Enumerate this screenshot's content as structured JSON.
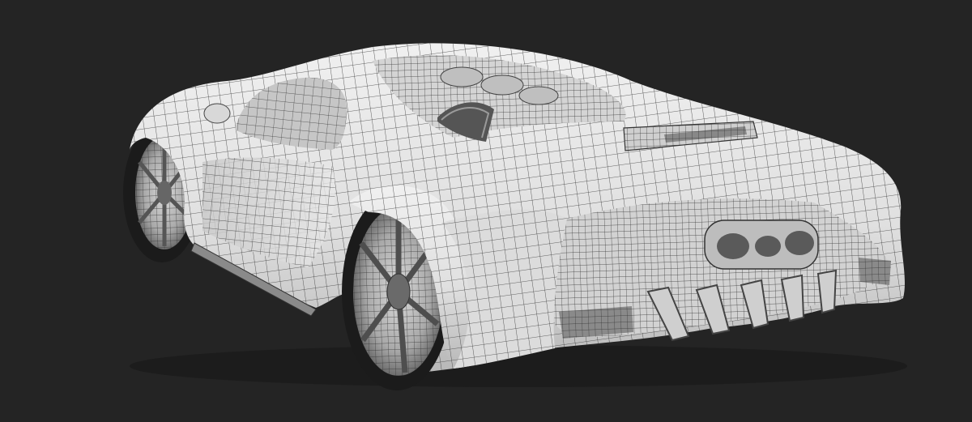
{
  "scene": {
    "subject": "wireframe-car-render",
    "background_color": "#242424",
    "surface_color": "#e2e2e2",
    "shadow_color": "#9a9a9a",
    "wire_color": "#3a3a3a",
    "tire_color": "#1b1b1b"
  }
}
